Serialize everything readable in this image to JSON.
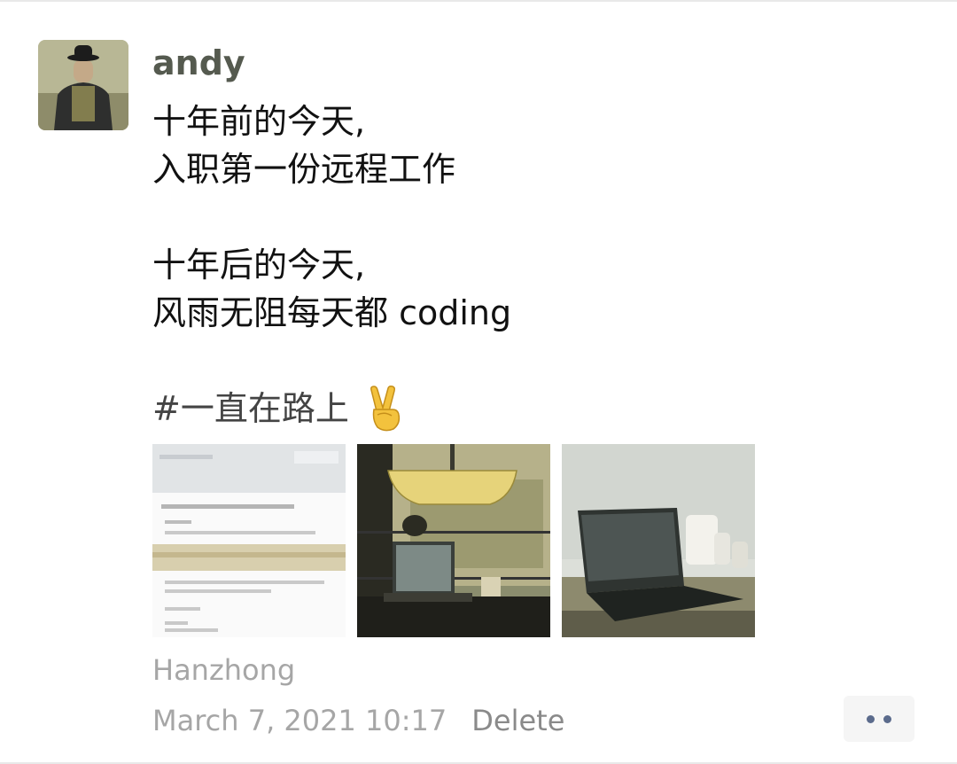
{
  "post": {
    "nickname": "andy",
    "lines": {
      "l1": "十年前的今天,",
      "l2": "入职第一份远程工作",
      "l3": "十年后的今天,",
      "l4": "风雨无阻每天都 coding",
      "hashtag": "#一直在路上"
    },
    "emoji_icon": "victory-hand-icon",
    "location": "Hanzhong",
    "timestamp": "March 7, 2021 10:17",
    "delete_label": "Delete",
    "more_icon": "more-dots-icon"
  },
  "colors": {
    "nickname": "#555a4f",
    "body_text": "#111111",
    "meta_text": "#a6a6a6",
    "more_dots": "#5b6b8c"
  }
}
